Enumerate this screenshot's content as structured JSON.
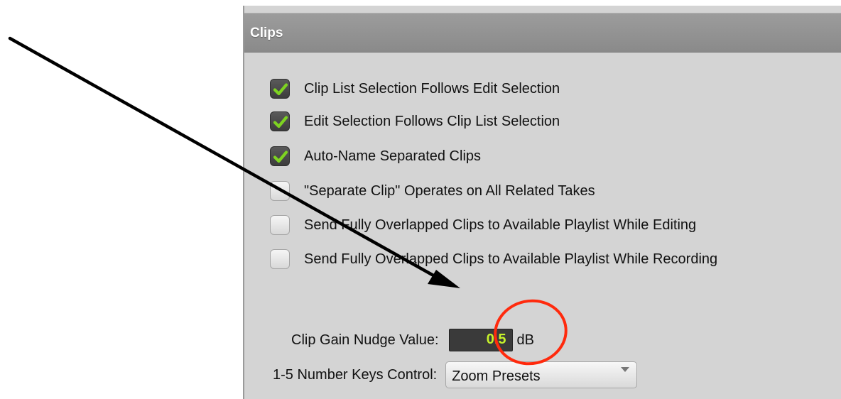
{
  "panel": {
    "title": "Clips"
  },
  "options": [
    {
      "label": "Clip List Selection Follows Edit Selection",
      "checked": true
    },
    {
      "label": "Edit Selection Follows Clip List Selection",
      "checked": true
    },
    {
      "label": "Auto-Name Separated Clips",
      "checked": true
    },
    {
      "label": "\"Separate Clip\" Operates on All Related Takes",
      "checked": false
    },
    {
      "label": "Send Fully Overlapped Clips to Available Playlist While Editing",
      "checked": false
    },
    {
      "label": "Send Fully Overlapped Clips to Available Playlist While Recording",
      "checked": false
    }
  ],
  "nudge": {
    "label": "Clip Gain Nudge Value:",
    "value": "0.5",
    "unit": "dB"
  },
  "number_keys": {
    "label": "1-5 Number Keys Control:",
    "selected": "Zoom Presets"
  },
  "colors": {
    "check_green": "#7ed321",
    "value_green": "#c6f22b",
    "annotation_red": "#ff2a0d",
    "arrow": "#000000"
  }
}
